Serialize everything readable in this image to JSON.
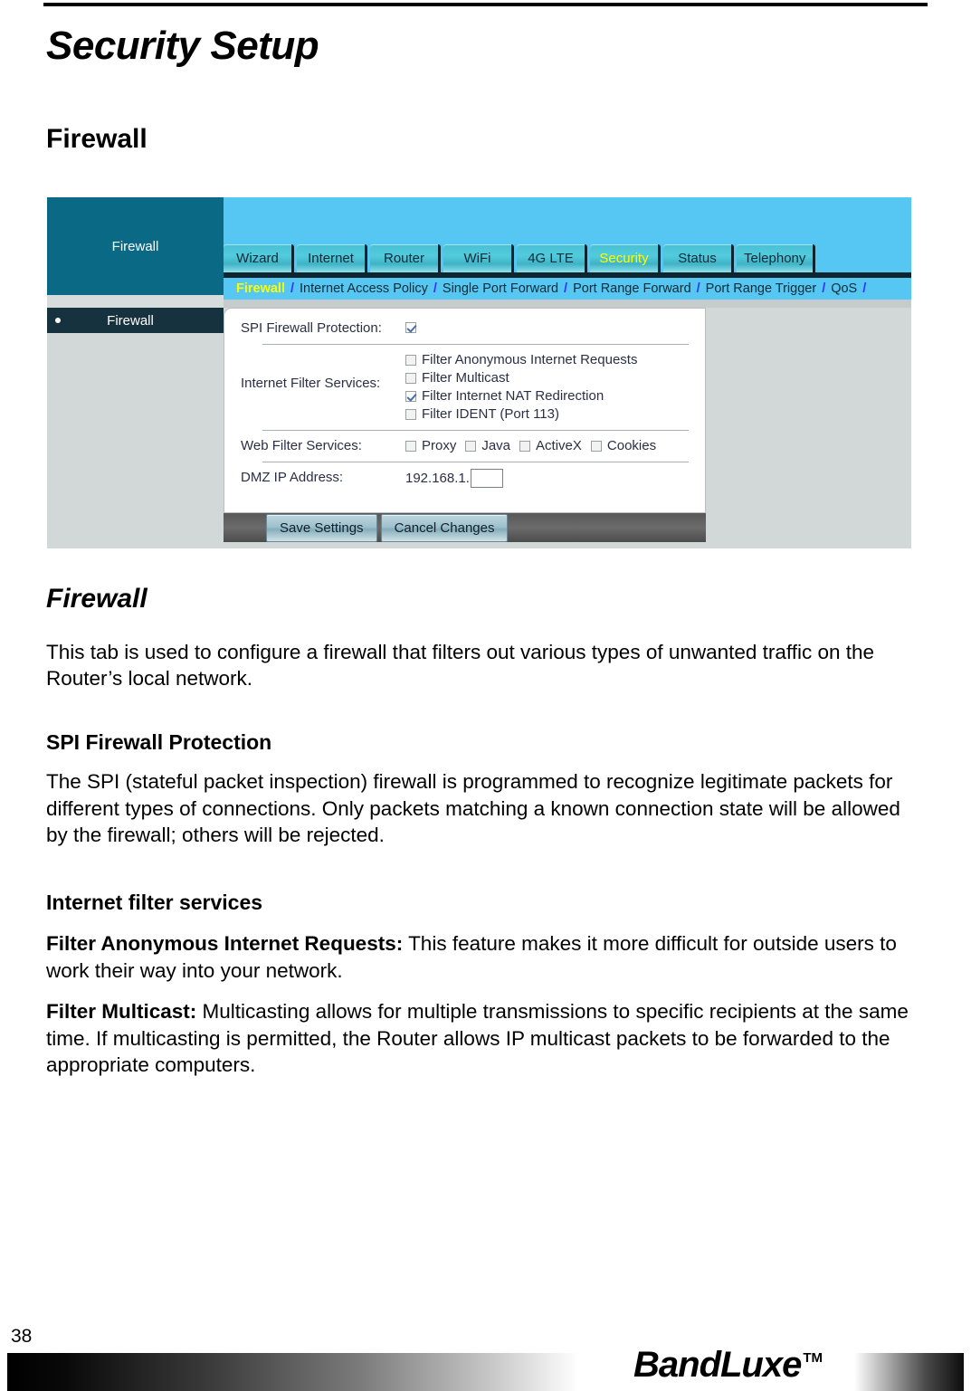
{
  "document": {
    "page_title": "Security Setup",
    "section_heading": "Firewall",
    "subsection_heading": "Firewall",
    "intro_paragraph": "This tab is used to configure a firewall that filters out various types of unwanted traffic on the Router’s local network.",
    "spi_heading": "SPI Firewall Protection",
    "spi_paragraph": "The SPI (stateful packet inspection) firewall is programmed to recognize legitimate packets for different types of connections. Only packets matching a known connection state will be allowed by the firewall; others will be rejected.",
    "filter_heading": "Internet filter services",
    "anonymous_label": "Filter Anonymous Internet Requests:",
    "anonymous_text": " This feature makes it more difficult for outside users to work their way into your network.",
    "multicast_label": "Filter Multicast:",
    "multicast_text": " Multicasting allows for multiple transmissions to specific recipients at the same time. If multicasting is permitted, the Router allows IP multicast packets to be forwarded to the appropriate computers.",
    "page_number": "38",
    "brand_name": "BandLuxe",
    "brand_tm": "TM"
  },
  "router_ui": {
    "brand_panel_label": "Firewall",
    "sidebar": {
      "items": [
        {
          "label": "Firewall",
          "selected": true
        }
      ]
    },
    "tabs": [
      {
        "label": "Wizard",
        "active": false
      },
      {
        "label": "Internet",
        "active": false
      },
      {
        "label": "Router",
        "active": false
      },
      {
        "label": "WiFi",
        "active": false
      },
      {
        "label": "4G LTE",
        "active": false
      },
      {
        "label": "Security",
        "active": true
      },
      {
        "label": "Status",
        "active": false
      },
      {
        "label": "Telephony",
        "active": false
      }
    ],
    "breadcrumbs": [
      {
        "label": "Firewall",
        "active": true
      },
      {
        "label": "Internet Access Policy",
        "active": false
      },
      {
        "label": "Single Port Forward",
        "active": false
      },
      {
        "label": "Port Range Forward",
        "active": false
      },
      {
        "label": "Port Range Trigger",
        "active": false
      },
      {
        "label": "QoS",
        "active": false
      }
    ],
    "breadcrumb_separator": "/",
    "form": {
      "spi_label": "SPI Firewall Protection:",
      "spi_checked": true,
      "internet_filter_label": "Internet Filter Services:",
      "internet_filter_options": [
        {
          "label": "Filter Anonymous Internet Requests",
          "checked": false
        },
        {
          "label": "Filter Multicast",
          "checked": false
        },
        {
          "label": "Filter Internet NAT Redirection",
          "checked": true
        },
        {
          "label": "Filter IDENT (Port 113)",
          "checked": false
        }
      ],
      "web_filter_label": "Web Filter Services:",
      "web_filter_options": [
        {
          "label": "Proxy",
          "checked": false
        },
        {
          "label": "Java",
          "checked": false
        },
        {
          "label": "ActiveX",
          "checked": false
        },
        {
          "label": "Cookies",
          "checked": false
        }
      ],
      "dmz_label": "DMZ IP Address:",
      "dmz_prefix": "192.168.1.",
      "dmz_value": ""
    },
    "buttons": {
      "save": "Save Settings",
      "cancel": "Cancel Changes"
    },
    "colors": {
      "brand_panel": "#0a6a85",
      "sidebar_selected": "#17323f",
      "top_band": "#55c7f2",
      "tab": "#49c0d4",
      "tab_active_text": "#fbff00",
      "breadcrumb_separator": "#3333ff",
      "panel_bg": "#d2d8d8"
    }
  }
}
